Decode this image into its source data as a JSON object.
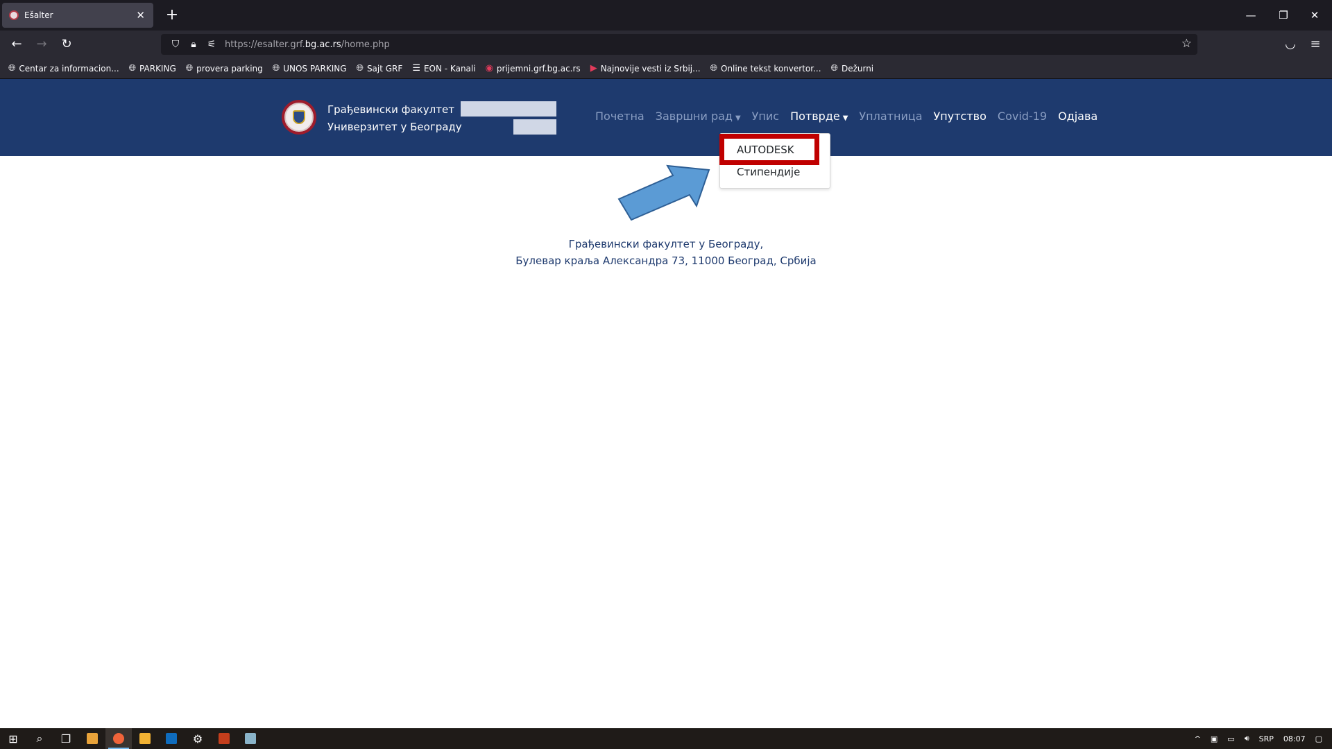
{
  "browser": {
    "tab_title": "Ešalter",
    "url_prefix": "https://esalter.grf.",
    "url_domain": "bg.ac.rs",
    "url_path": "/home.php",
    "bookmarks": [
      {
        "label": "Centar za informacion...",
        "icon": "globe-icon"
      },
      {
        "label": "PARKING",
        "icon": "globe-icon"
      },
      {
        "label": "provera parking",
        "icon": "globe-icon"
      },
      {
        "label": "UNOS PARKING",
        "icon": "globe-icon"
      },
      {
        "label": "Sajt GRF",
        "icon": "globe-icon"
      },
      {
        "label": "EON - Kanali",
        "icon": "list-icon"
      },
      {
        "label": "prijemni.grf.bg.ac.rs",
        "icon": "faculty-icon"
      },
      {
        "label": "Najnovije vesti iz Srbij...",
        "icon": "video-icon"
      },
      {
        "label": "Online tekst konvertor...",
        "icon": "globe-icon"
      },
      {
        "label": "Dežurni",
        "icon": "globe-icon"
      }
    ]
  },
  "site": {
    "brand_line1": "Грађевински факултет",
    "brand_line2": "Универзитет у Београду",
    "menu": [
      {
        "label": "Почетна",
        "active": false,
        "caret": false
      },
      {
        "label": "Завршни рад",
        "active": false,
        "caret": true
      },
      {
        "label": "Упис",
        "active": false,
        "caret": false
      },
      {
        "label": "Потврде",
        "active": true,
        "caret": true
      },
      {
        "label": "Уплатница",
        "active": false,
        "caret": false
      },
      {
        "label": "Упутство",
        "active": true,
        "caret": false
      },
      {
        "label": "Covid-19",
        "active": false,
        "caret": false
      },
      {
        "label": "Одјава",
        "active": true,
        "caret": false
      }
    ],
    "dropdown": [
      "AUTODESK",
      "Стипендије"
    ],
    "address_line1": "Грађевински факултет у Београду,",
    "address_line2": "Булевар краља Александра 73, 11000 Београд, Србија"
  },
  "taskbar": {
    "language": "SRP",
    "time": "08:07"
  },
  "colors": {
    "header_bg": "#1e3a6e",
    "highlight": "#c00000",
    "arrow": "#5b9bd5"
  }
}
